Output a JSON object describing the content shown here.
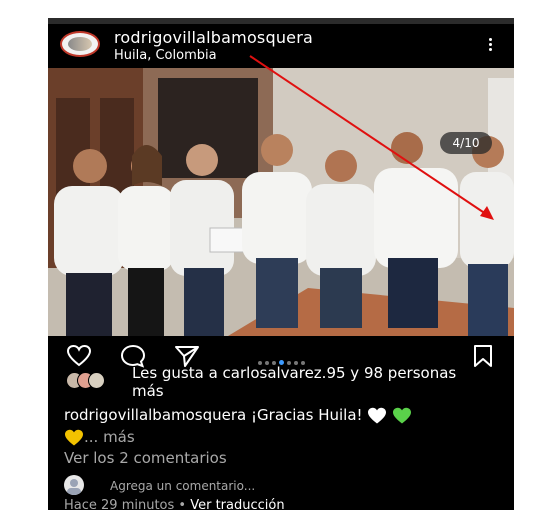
{
  "post": {
    "username": "rodrigovillalbamosquera",
    "location": "Huila, Colombia",
    "counter": "4/10",
    "likes_text": "Les gusta a carlosalvarez.95 y 98 personas más",
    "caption_user": "rodrigovillalbamosquera",
    "caption_text": " ¡Gracias Huila! ",
    "caption_more": "... más",
    "comments_link": "Ver los 2 comentarios",
    "add_comment": "Agrega un comentario...",
    "time_ago": "Hace 29 minutos",
    "separator": " • ",
    "translation": "Ver traducción"
  },
  "carousel": {
    "total_dots": 7,
    "active_index": 3
  },
  "colors": {
    "background": "#000000",
    "heart_white": "#ffffff",
    "heart_green": "#5ad14a",
    "heart_yellow": "#f2c200",
    "arrow": "#e01010",
    "active_dot": "#3d9bff"
  },
  "icons": [
    "more-options-icon",
    "heart-icon",
    "comment-icon",
    "share-icon",
    "bookmark-icon"
  ]
}
